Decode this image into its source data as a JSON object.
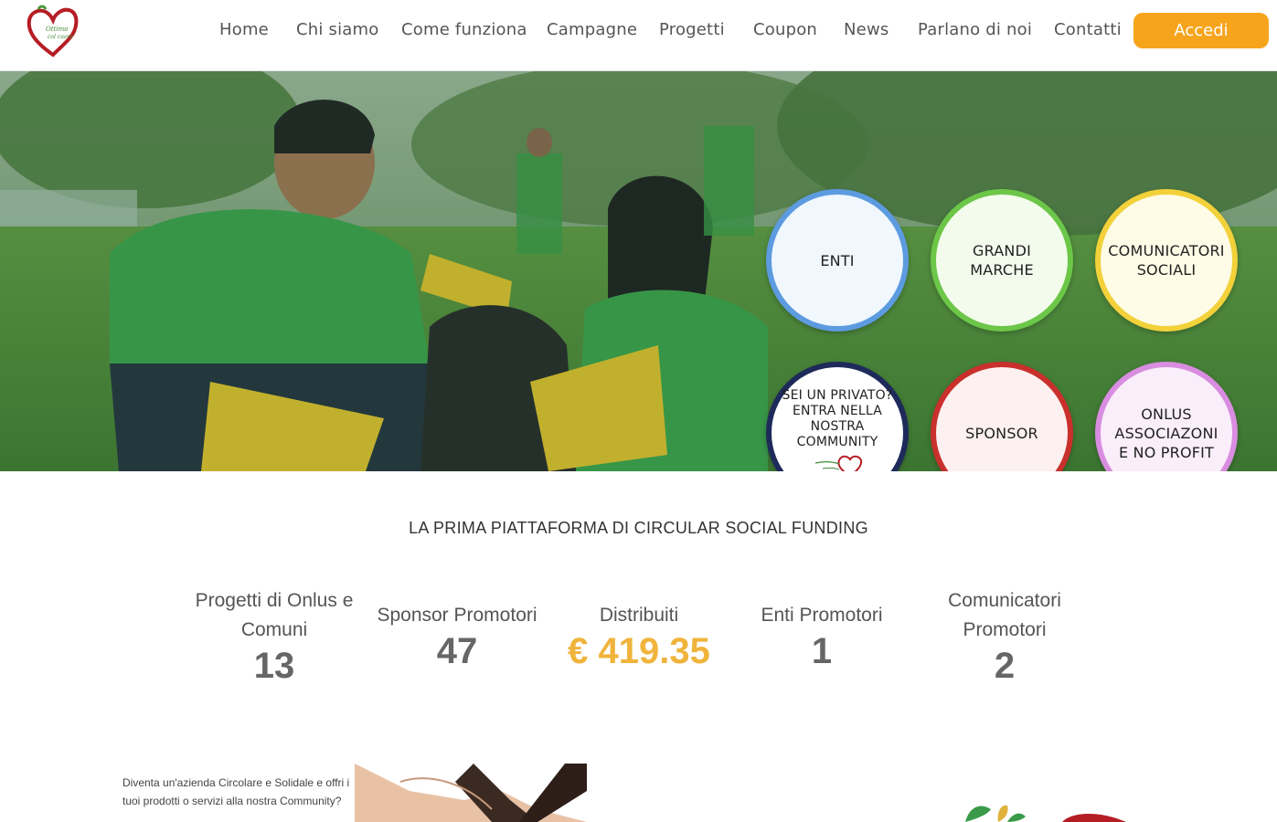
{
  "nav": {
    "items": [
      {
        "label": "Home"
      },
      {
        "label": "Chi siamo"
      },
      {
        "label": "Come funziona"
      },
      {
        "label": "Campagne"
      },
      {
        "label": "Progetti"
      },
      {
        "label": "Coupon"
      },
      {
        "label": "News"
      },
      {
        "label": "Parlano di noi"
      },
      {
        "label": "Contatti"
      }
    ],
    "login_label": "Accedi"
  },
  "hero": {
    "circles": {
      "enti": "ENTI",
      "grandi_marche": "GRANDI\nMARCHE",
      "comunicatori": "COMUNICATORI\nSOCIALI",
      "privato": "SEI UN PRIVATO?\nENTRA NELLA\nNOSTRA\nCOMMUNITY",
      "sponsor": "SPONSOR",
      "onlus": "ONLUS\nASSOCIAZONI\nE NO PROFIT"
    }
  },
  "tagline": "LA PRIMA PIATTAFORMA DI CIRCULAR SOCIAL FUNDING",
  "stats": [
    {
      "label": "Progetti di Onlus e Comuni",
      "value": "13"
    },
    {
      "label": "Sponsor Promotori",
      "value": "47"
    },
    {
      "label": "Distribuiti",
      "value": "€ 419.35"
    },
    {
      "label": "Enti Promotori",
      "value": "1"
    },
    {
      "label": "Comunicatori Promotori",
      "value": "2"
    }
  ],
  "promo": {
    "text": "Diventa un'azienda Circolare e Solidale e offri i tuoi prodotti o servizi alla nostra Community?"
  },
  "colors": {
    "accent": "#f7a41d",
    "money": "#f0b43c",
    "enti_border": "#5d9be0",
    "grandi_border": "#6cc648",
    "comunicatori_border": "#f2d13a",
    "privato_border": "#1d2a5a",
    "sponsor_border": "#c9302c",
    "onlus_border": "#d98de0"
  }
}
